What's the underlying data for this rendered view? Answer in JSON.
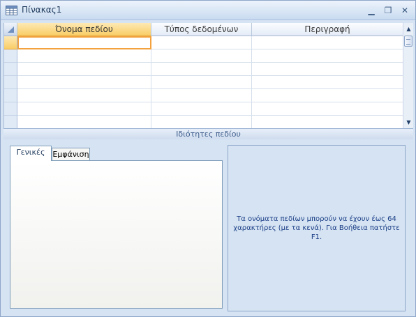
{
  "window": {
    "title": "Πίνακας1",
    "icon": "table-icon",
    "controls": {
      "minimize": "▁",
      "maximize": "❐",
      "close": "✕"
    }
  },
  "grid": {
    "columns": [
      "Όνομα πεδίου",
      "Τύπος δεδομένων",
      "Περιγραφή"
    ],
    "active_column_index": 0,
    "rows": [
      [
        "",
        "",
        ""
      ],
      [
        "",
        "",
        ""
      ],
      [
        "",
        "",
        ""
      ],
      [
        "",
        "",
        ""
      ],
      [
        "",
        "",
        ""
      ],
      [
        "",
        "",
        ""
      ],
      [
        "",
        "",
        ""
      ]
    ]
  },
  "scrollbar": {
    "up_arrow": "▲",
    "down_arrow": "▼"
  },
  "field_properties": {
    "caption": "Ιδιότητες πεδίου",
    "tabs": [
      "Γενικές",
      "Εμφάνιση"
    ],
    "active_tab": "Γενικές",
    "help_text": "Τα ονόματα πεδίων μπορούν να έχουν έως 64 χαρακτήρες (με τα κενά). Για Βοήθεια πατήστε F1."
  },
  "colors": {
    "active_header": "#f9cd66",
    "focus_border": "#f3a23d",
    "panel_bg": "#d5e3f3"
  }
}
